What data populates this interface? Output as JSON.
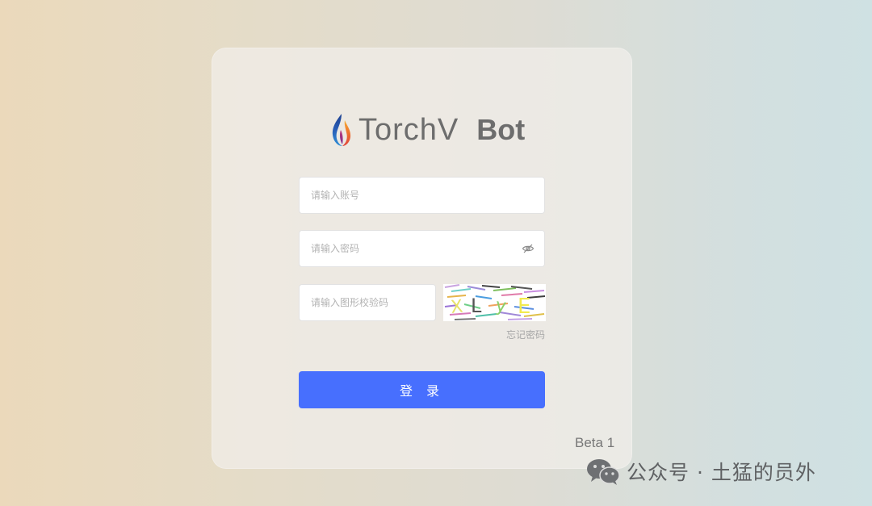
{
  "logo": {
    "brand": "TorchV",
    "product": "Bot"
  },
  "form": {
    "account_placeholder": "请输入账号",
    "password_placeholder": "请输入密码",
    "captcha_placeholder": "请输入图形校验码",
    "captcha_text": "XLyE",
    "forgot_label": "忘记密码",
    "login_label": "登 录"
  },
  "version": "Beta 1",
  "watermark": {
    "text": "公众号 · 土猛的员外"
  },
  "icons": {
    "password_toggle": "eye-off-icon",
    "logo": "flame-logo-icon",
    "watermark": "wechat-icon"
  },
  "colors": {
    "primary": "#476ffe",
    "card": "#f1efea",
    "text_muted": "#a7a7a7"
  }
}
